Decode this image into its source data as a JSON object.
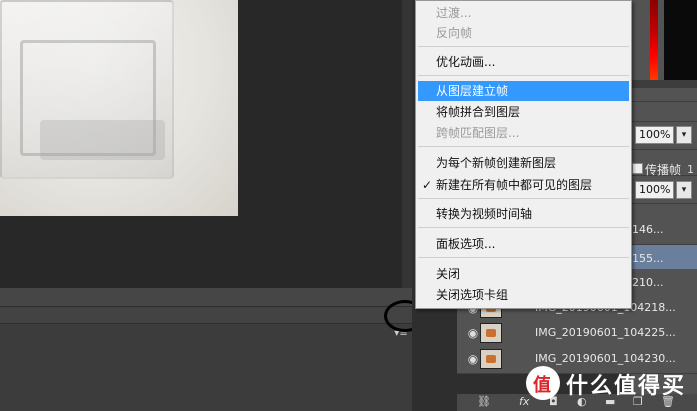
{
  "menu": {
    "items": [
      {
        "label": "过渡...",
        "state": "disabled"
      },
      {
        "label": "反向帧",
        "state": "disabled"
      },
      {
        "label": "优化动画...",
        "state": "normal"
      },
      {
        "label": "从图层建立帧",
        "state": "active"
      },
      {
        "label": "将帧拼合到图层",
        "state": "normal"
      },
      {
        "label": "跨帧匹配图层...",
        "state": "disabled"
      },
      {
        "label": "为每个新帧创建新图层",
        "state": "normal"
      },
      {
        "label": "新建在所有帧中都可见的图层",
        "state": "checked"
      },
      {
        "label": "转换为视频时间轴",
        "state": "normal"
      },
      {
        "label": "面板选项...",
        "state": "normal"
      },
      {
        "label": "关闭",
        "state": "normal"
      },
      {
        "label": "关闭选项卡组",
        "state": "normal"
      }
    ],
    "check_mark": "✓"
  },
  "layers_panel": {
    "opacity_value": "100%",
    "fill_value": "100%",
    "propagate_label": "传播帧",
    "propagate_number": "1",
    "layer_names_truncated": [
      "146...",
      "155...",
      "210..."
    ],
    "layers": [
      {
        "name": "IMG_20190601_104218...",
        "visible": true
      },
      {
        "name": "IMG_20190601_104225...",
        "visible": true
      },
      {
        "name": "IMG_20190601_104230...",
        "visible": true
      }
    ],
    "bottom_icons": [
      "link-icon",
      "fx-icon",
      "mask-icon",
      "adjustment-icon",
      "folder-icon",
      "new-layer-icon",
      "trash-icon"
    ],
    "fx_label": "fx"
  },
  "timeline": {
    "menu_glyph": "▾≡"
  },
  "watermark": {
    "text": "什么值得买"
  },
  "colors": {
    "menu_highlight": "#3399ff",
    "selected_layer": "#6a7f9c",
    "panel_bg": "#535353",
    "canvas_bg": "#282828"
  }
}
